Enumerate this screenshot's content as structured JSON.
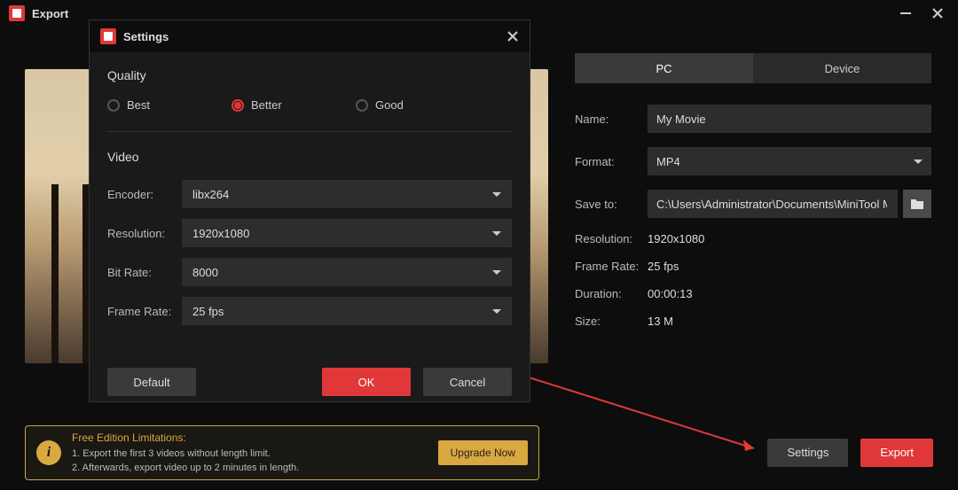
{
  "window": {
    "title": "Export"
  },
  "right": {
    "tabs": [
      "PC",
      "Device"
    ],
    "name_label": "Name:",
    "name_value": "My Movie",
    "format_label": "Format:",
    "format_value": "MP4",
    "saveto_label": "Save to:",
    "saveto_value": "C:\\Users\\Administrator\\Documents\\MiniTool Movie",
    "resolution_label": "Resolution:",
    "resolution_value": "1920x1080",
    "framerate_label": "Frame Rate:",
    "framerate_value": "25 fps",
    "duration_label": "Duration:",
    "duration_value": "00:00:13",
    "size_label": "Size:",
    "size_value": "13 M"
  },
  "bottom": {
    "limitations_title": "Free Edition Limitations:",
    "limitations_line1": "1. Export the first 3 videos without length limit.",
    "limitations_line2": "2. Afterwards, export video up to 2 minutes in length.",
    "upgrade_label": "Upgrade Now",
    "settings_label": "Settings",
    "export_label": "Export"
  },
  "modal": {
    "title": "Settings",
    "quality_title": "Quality",
    "quality_options": [
      "Best",
      "Better",
      "Good"
    ],
    "quality_selected": "Better",
    "video_title": "Video",
    "encoder_label": "Encoder:",
    "encoder_value": "libx264",
    "resolution_label": "Resolution:",
    "resolution_value": "1920x1080",
    "bitrate_label": "Bit Rate:",
    "bitrate_value": "8000",
    "framerate_label": "Frame Rate:",
    "framerate_value": "25 fps",
    "default_label": "Default",
    "ok_label": "OK",
    "cancel_label": "Cancel"
  }
}
